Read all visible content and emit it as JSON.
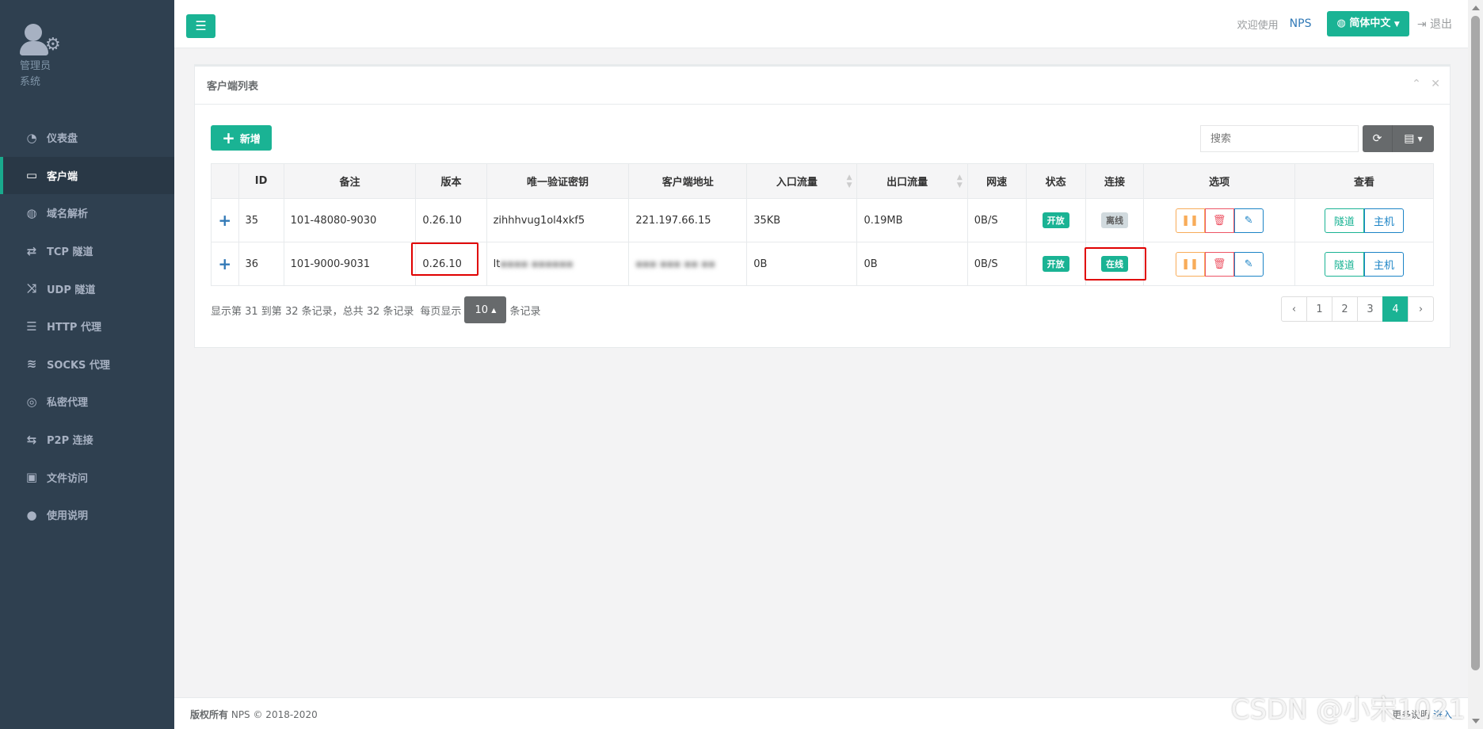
{
  "profile": {
    "role": "管理员",
    "subtitle": "系统"
  },
  "sidebar": {
    "items": [
      {
        "label": "仪表盘",
        "icon": "dashboard-icon",
        "glyph": "◔"
      },
      {
        "label": "客户端",
        "icon": "desktop-icon",
        "glyph": "▭",
        "active": true
      },
      {
        "label": "域名解析",
        "icon": "globe-icon",
        "glyph": "◍"
      },
      {
        "label": "TCP 隧道",
        "icon": "retweet-icon",
        "glyph": "⇄"
      },
      {
        "label": "UDP 隧道",
        "icon": "random-icon",
        "glyph": "⤨"
      },
      {
        "label": "HTTP 代理",
        "icon": "list-icon",
        "glyph": "☰"
      },
      {
        "label": "SOCKS 代理",
        "icon": "layers-icon",
        "glyph": "≋"
      },
      {
        "label": "私密代理",
        "icon": "eye-slash-icon",
        "glyph": "◎"
      },
      {
        "label": "P2P 连接",
        "icon": "exchange-icon",
        "glyph": "⇆"
      },
      {
        "label": "文件访问",
        "icon": "briefcase-icon",
        "glyph": "▣"
      },
      {
        "label": "使用说明",
        "icon": "lightbulb-icon",
        "glyph": "●"
      }
    ]
  },
  "header": {
    "welcome": "欢迎使用",
    "brand": "NPS",
    "language": "简体中文",
    "logout": "退出"
  },
  "panel": {
    "title": "客户端列表",
    "add_label": "新增",
    "search_placeholder": "搜索"
  },
  "table": {
    "columns": [
      "ID",
      "备注",
      "版本",
      "唯一验证密钥",
      "客户端地址",
      "入口流量",
      "出口流量",
      "网速",
      "状态",
      "连接",
      "选项",
      "查看"
    ],
    "rows": [
      {
        "id": "35",
        "remark": "101-48080-9030",
        "version": "0.26.10",
        "key": "zihhhvug1ol4xkf5",
        "address": "221.197.66.15",
        "in_flow": "35KB",
        "out_flow": "0.19MB",
        "speed": "0B/S",
        "status": "开放",
        "connection": "离线",
        "tunnel": "隧道",
        "host": "主机"
      },
      {
        "id": "36",
        "remark": "101-9000-9031",
        "version": "0.26.10",
        "key": "lt",
        "address": "",
        "in_flow": "0B",
        "out_flow": "0B",
        "speed": "0B/S",
        "status": "开放",
        "connection": "在线",
        "tunnel": "隧道",
        "host": "主机"
      }
    ]
  },
  "pagination": {
    "summary": "显示第 31 到第 32 条记录，总共 32 条记录",
    "per_page_prefix": "每页显示",
    "per_page": "10",
    "per_page_suffix": "条记录",
    "pages": [
      "‹",
      "1",
      "2",
      "3",
      "4",
      "›"
    ],
    "current": "4"
  },
  "footer": {
    "copyright_label": "版权所有",
    "copyright_text": "NPS © 2018-2020",
    "more_label": "更多说明",
    "enter": "进入"
  },
  "watermark": "CSDN @小宋1021",
  "colors": {
    "accent": "#1ab394",
    "sidebar": "#2f4050",
    "danger": "#ed5565",
    "warning": "#f8ac59",
    "info": "#1c84c6",
    "highlight": "#e00000"
  }
}
